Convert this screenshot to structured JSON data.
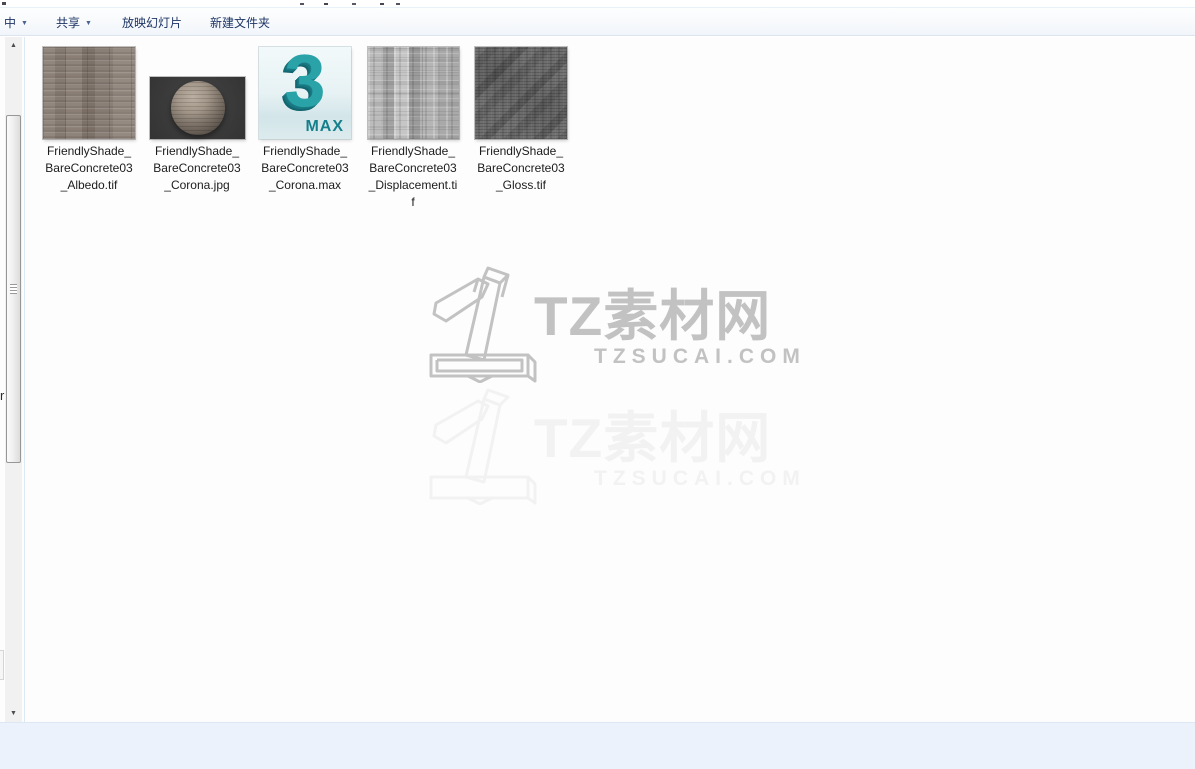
{
  "toolbar": {
    "items": [
      {
        "label": "中",
        "caret": "▼"
      },
      {
        "label": "共享",
        "caret": "▼"
      },
      {
        "label": "放映幻灯片"
      },
      {
        "label": "新建文件夹"
      }
    ]
  },
  "left_pane": {
    "clipped_text": "r"
  },
  "icons": {
    "scroll_up": "▲",
    "scroll_down": "▼",
    "max_glyph": "3",
    "max_label": "MAX"
  },
  "files": [
    {
      "name": "FriendlyShade_BareConcrete03_Albedo.tif",
      "lines": [
        "FriendlyShade_",
        "BareConcrete03",
        "_Albedo.tif"
      ],
      "thumb": "concrete-albedo-texture"
    },
    {
      "name": "FriendlyShade_BareConcrete03_Corona.jpg",
      "lines": [
        "FriendlyShade_",
        "BareConcrete03",
        "_Corona.jpg"
      ],
      "thumb": "concrete-sphere-render"
    },
    {
      "name": "FriendlyShade_BareConcrete03_Corona.max",
      "lines": [
        "FriendlyShade_",
        "BareConcrete03",
        "_Corona.max"
      ],
      "thumb": "3dsmax-file-icon"
    },
    {
      "name": "FriendlyShade_BareConcrete03_Displacement.tif",
      "lines": [
        "FriendlyShade_",
        "BareConcrete03",
        "_Displacement.ti",
        "f"
      ],
      "thumb": "concrete-displacement-texture"
    },
    {
      "name": "FriendlyShade_BareConcrete03_Gloss.tif",
      "lines": [
        "FriendlyShade_",
        "BareConcrete03",
        "_Gloss.tif"
      ],
      "thumb": "concrete-gloss-texture"
    }
  ],
  "watermark": {
    "brand": "TZ素材网",
    "domain": "TZSUCAI.COM",
    "logo": "number-1-outline-logo",
    "color": "#c2c2c2",
    "ghost_color": "#f2f2f2"
  },
  "colors": {
    "toolbar_text": "#1e3565",
    "content_background": "#fdfdfd",
    "details_pane": "#ecf2fb",
    "max_teal": "#2aa3a8"
  }
}
